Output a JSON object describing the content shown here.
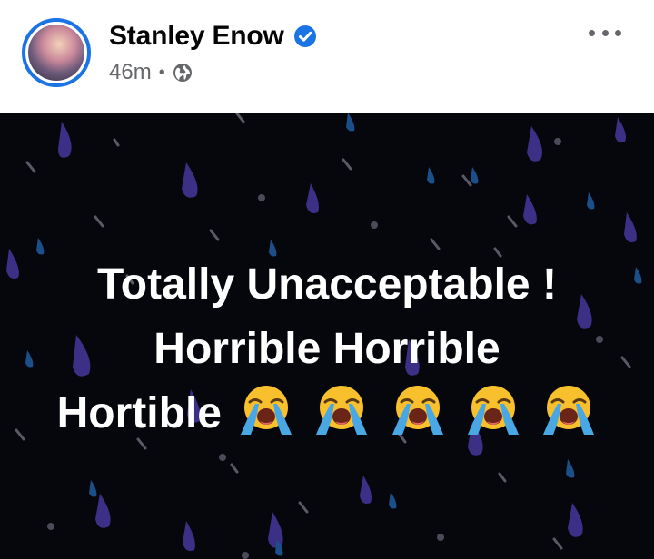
{
  "post": {
    "author": "Stanley Enow",
    "time": "46m",
    "separator": "•",
    "lines": [
      "Totally Unacceptable !",
      "Horrible Horrible",
      "Hortible"
    ],
    "emoji_name": "loudly-crying-face-icon",
    "emoji_count": 5
  },
  "colors": {
    "verified": "#1b74e4",
    "background": "#05070c",
    "drop_purple": "#3c2f86",
    "drop_blue": "#1a4f8a",
    "meta": "#65676b"
  }
}
